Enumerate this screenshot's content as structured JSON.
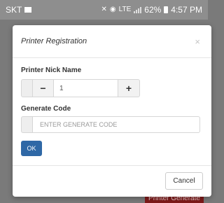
{
  "status_bar": {
    "carrier": "SKT",
    "network": "LTE",
    "battery": "62%",
    "time": "4:57 PM"
  },
  "background": {
    "button_label": "Printer Generate"
  },
  "dialog": {
    "title": "Printer Registration",
    "close_symbol": "×",
    "nick_name_label": "Printer Nick Name",
    "minus_symbol": "−",
    "plus_symbol": "+",
    "nick_name_value": "1",
    "generate_code_label": "Generate Code",
    "generate_code_placeholder": "ENTER GENERATE CODE",
    "ok_label": "OK",
    "cancel_label": "Cancel"
  },
  "colors": {
    "primary": "#2f68a6",
    "backdrop": "#7a7a7a"
  }
}
